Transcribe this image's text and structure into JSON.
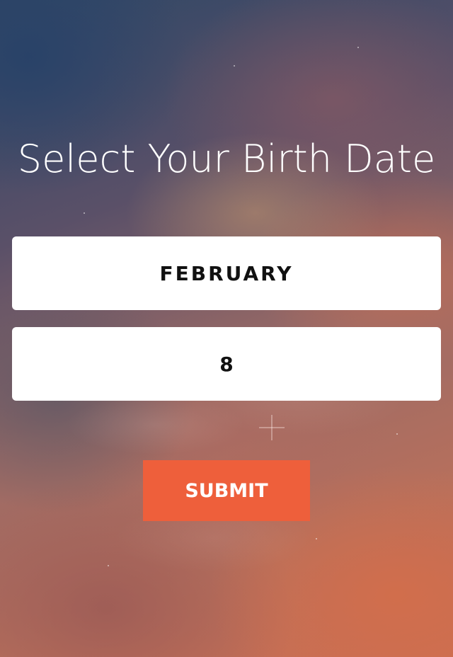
{
  "page": {
    "title": "Select Your Birth Date"
  },
  "form": {
    "month_value": "FEBRUARY",
    "day_value": "8",
    "submit_label": "SUBMIT"
  },
  "colors": {
    "submit_button": "#ee5f3b",
    "field_background": "#ffffff",
    "title_text": "#ffffff"
  }
}
